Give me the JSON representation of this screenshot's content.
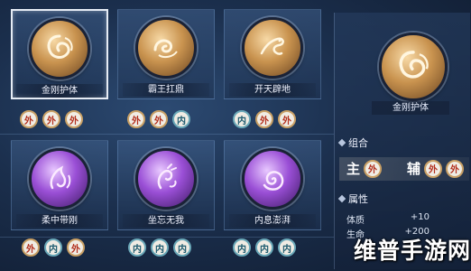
{
  "skills": [
    {
      "name": "金刚护体",
      "style": "gold",
      "selected": true,
      "icon": "phoenix-swirl-icon",
      "badges": [
        "外",
        "外",
        "外"
      ]
    },
    {
      "name": "霸王扛鼎",
      "style": "gold",
      "selected": false,
      "icon": "cloud-swirl-icon",
      "badges": [
        "外",
        "外",
        "内"
      ]
    },
    {
      "name": "开天辟地",
      "style": "gold",
      "selected": false,
      "icon": "dragon-icon",
      "badges": [
        "内",
        "外",
        "外"
      ]
    },
    {
      "name": "柔中带刚",
      "style": "purple",
      "selected": false,
      "icon": "flame-swirl-icon",
      "badges": [
        "外",
        "内",
        "外"
      ]
    },
    {
      "name": "坐忘无我",
      "style": "purple",
      "selected": false,
      "icon": "bird-swirl-icon",
      "badges": [
        "内",
        "内",
        "内"
      ]
    },
    {
      "name": "内息澎湃",
      "style": "purple",
      "selected": false,
      "icon": "vortex-icon",
      "badges": [
        "内",
        "内",
        "内"
      ]
    }
  ],
  "detail": {
    "name": "金刚护体",
    "icon": "phoenix-swirl-icon",
    "combo_title": "组合",
    "combo_main_label": "主",
    "combo_main_badges": [
      "外"
    ],
    "combo_assist_label": "辅",
    "combo_assist_badges": [
      "外",
      "外"
    ],
    "attr_title": "属性",
    "stats": [
      {
        "label": "体质",
        "value": "+10"
      },
      {
        "label": "生命",
        "value": "+200"
      }
    ]
  },
  "watermark": "维普手游网",
  "colors": {
    "wai": "#b3301e",
    "nei": "#1b5a6e",
    "badge_bg": "#f0ece4"
  }
}
